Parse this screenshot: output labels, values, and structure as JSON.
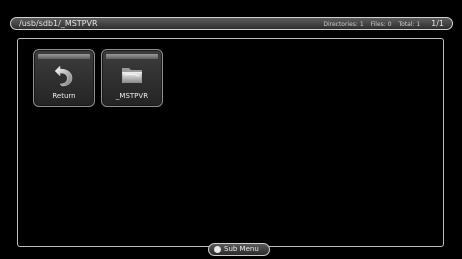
{
  "header": {
    "path": "/usb/sdb1/_MSTPVR",
    "directories": "Directories: 1",
    "files": "Files: 0",
    "total": "Total: 1",
    "page": "1/1"
  },
  "items": [
    {
      "label": "Return",
      "icon": "return-arrow-icon"
    },
    {
      "label": "_MSTPVR",
      "icon": "folder-icon"
    }
  ],
  "submenu": {
    "label": "Sub Menu"
  }
}
